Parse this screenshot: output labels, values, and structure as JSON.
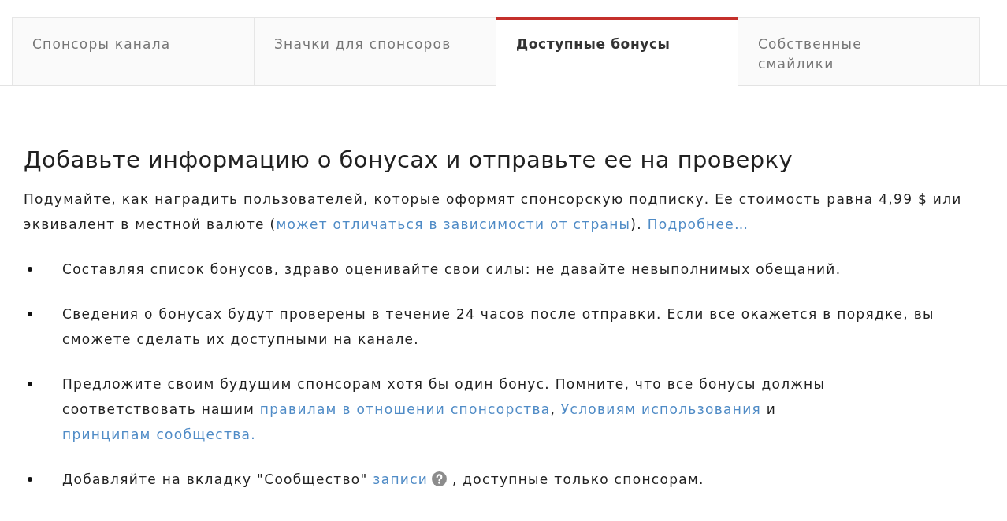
{
  "tabs": [
    {
      "label": "Спонсоры канала",
      "selected": false
    },
    {
      "label": "Значки для спонсоров",
      "selected": false
    },
    {
      "label": "Доступные бонусы",
      "selected": true
    },
    {
      "label": "Собственные\nсмайлики",
      "selected": false
    }
  ],
  "heading": "Добавьте информацию о бонусах и отправьте ее на проверку",
  "intro": [
    {
      "kind": "text",
      "text": "Подумайте, как наградить пользователей, которые оформят спонсорскую подписку. Ее стоимость равна 4,99 $ или эквивалент в местной валюте ("
    },
    {
      "kind": "link",
      "text": "может отличаться в зависимости от страны"
    },
    {
      "kind": "text",
      "text": "). "
    },
    {
      "kind": "link",
      "text": "Подробнее…"
    }
  ],
  "bullets": [
    {
      "parts": [
        {
          "kind": "text",
          "text": "Составляя список бонусов, здраво оценивайте свои силы: не давайте невыполнимых обещаний."
        }
      ]
    },
    {
      "parts": [
        {
          "kind": "text",
          "text": "Сведения о бонусах будут проверены в течение 24 часов после отправки. Если все окажется в порядке, вы сможете сделать их доступными на канале."
        }
      ]
    },
    {
      "parts": [
        {
          "kind": "text",
          "text": "Предложите своим будущим спонсорам хотя бы один бонус. Помните, что все бонусы должны соответствовать нашим "
        },
        {
          "kind": "link",
          "text": "правилам в отношении спонсорства"
        },
        {
          "kind": "text",
          "text": ", "
        },
        {
          "kind": "link",
          "text": "Условиям использования"
        },
        {
          "kind": "text",
          "text": " и "
        },
        {
          "kind": "link",
          "text": "принципам сообщества."
        }
      ]
    },
    {
      "parts": [
        {
          "kind": "text",
          "text": "Добавляйте на вкладку \"Сообщество\" "
        },
        {
          "kind": "link",
          "text": "записи"
        },
        {
          "kind": "help"
        },
        {
          "kind": "text",
          "text": " , доступные только спонсорам."
        }
      ]
    }
  ]
}
